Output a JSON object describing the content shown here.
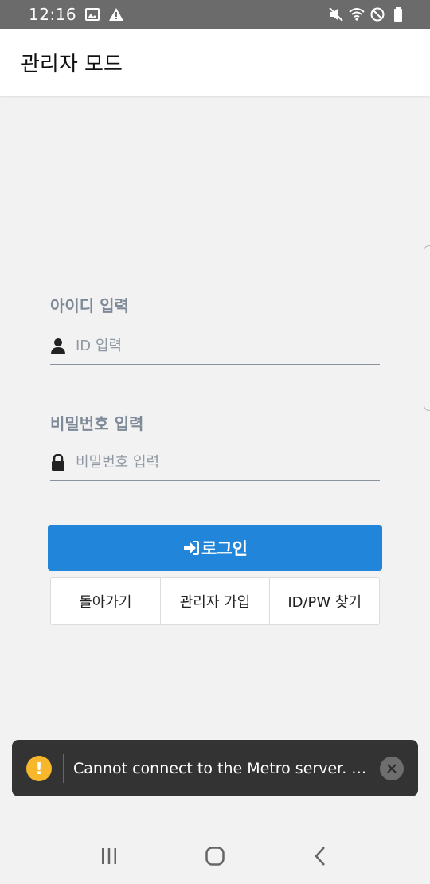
{
  "status_bar": {
    "time": "12:16",
    "icons": [
      "image-icon",
      "alert-icon",
      "mute-icon",
      "wifi-icon",
      "do-not-disturb-icon",
      "battery-icon"
    ]
  },
  "app_bar": {
    "title": "관리자 모드"
  },
  "form": {
    "id_label": "아이디 입력",
    "id_placeholder": "ID 입력",
    "password_label": "비밀번호 입력",
    "password_placeholder": "비밀번호 입력"
  },
  "buttons": {
    "login": "로그인",
    "back": "돌아가기",
    "register": "관리자 가입",
    "find": "ID/PW 찾기"
  },
  "toast": {
    "message": "Cannot connect to the Metro server.  Try reloading"
  },
  "colors": {
    "primary": "#2185d9",
    "label": "#7e8a97",
    "toast_bg": "#333333",
    "warn": "#f6b72a"
  }
}
